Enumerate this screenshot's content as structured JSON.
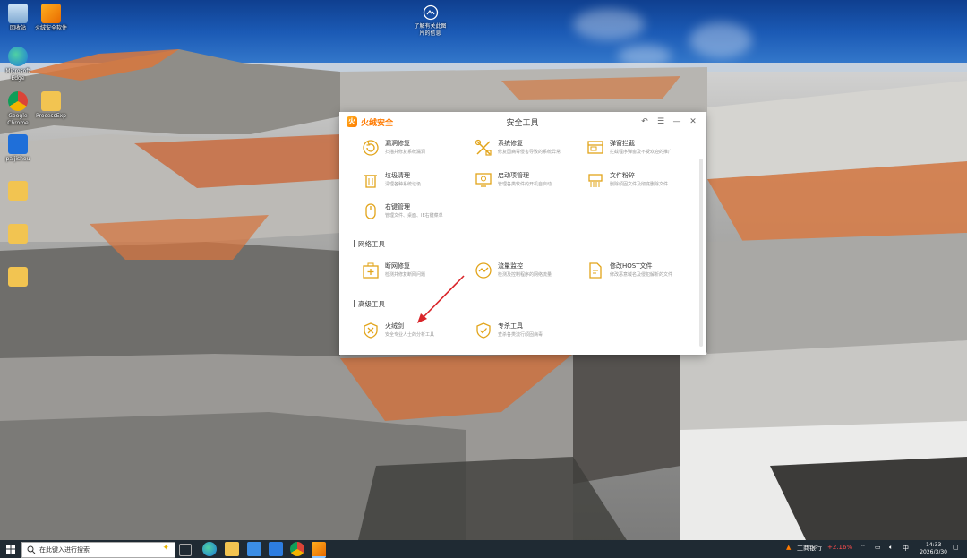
{
  "desktop": {
    "icons": [
      {
        "label": "回收站",
        "icon": "recycle-bin-icon"
      },
      {
        "label": "火绒安全软件",
        "icon": "huorong-icon"
      },
      {
        "label": "Microsoft Edge",
        "icon": "edge-icon"
      },
      {
        "label": "Google Chrome",
        "icon": "chrome-icon"
      },
      {
        "label": "ProcessExp",
        "icon": "folder-icon"
      },
      {
        "label": "paijishou",
        "icon": "app-icon"
      },
      {
        "label": "",
        "icon": "folder-icon"
      },
      {
        "label": "",
        "icon": "folder-icon"
      },
      {
        "label": "",
        "icon": "folder-icon"
      }
    ],
    "center_icon": {
      "label_line1": "了解有关此图",
      "label_line2": "片的信息"
    }
  },
  "window": {
    "app_name": "火绒安全",
    "title": "安全工具",
    "controls": [
      "↶",
      "☰",
      "—",
      "✕"
    ],
    "sections": [
      {
        "title": "",
        "tools": [
          {
            "name": "漏洞修复",
            "desc": "扫描并修复系统漏洞",
            "icon": "refresh-icon"
          },
          {
            "name": "系统修复",
            "desc": "修复因病毒侵害导致的系统异常",
            "icon": "wrench-icon"
          },
          {
            "name": "弹窗拦截",
            "desc": "拦截程序弹窗及不受欢迎的推广",
            "icon": "popup-icon"
          },
          {
            "name": "垃圾清理",
            "desc": "清理各种系统垃圾",
            "icon": "trash-icon"
          },
          {
            "name": "启动项管理",
            "desc": "管理各类软件的开机自启动",
            "icon": "monitor-icon"
          },
          {
            "name": "文件粉碎",
            "desc": "删除顽固文件及彻底删除文件",
            "icon": "shredder-icon"
          },
          {
            "name": "右键管理",
            "desc": "管理文件、桌面、IE右键菜单",
            "icon": "mouse-icon"
          }
        ]
      },
      {
        "title": "网络工具",
        "tools": [
          {
            "name": "断网修复",
            "desc": "检测并修复断网问题",
            "icon": "medkit-icon"
          },
          {
            "name": "流量监控",
            "desc": "检测及控制程序的网络流量",
            "icon": "traffic-icon"
          },
          {
            "name": "修改HOST文件",
            "desc": "修改恶意域名及侵犯解析的文件",
            "icon": "file-edit-icon"
          }
        ]
      },
      {
        "title": "高级工具",
        "tools": [
          {
            "name": "火绒剑",
            "desc": "安全专业人士的分析工具",
            "icon": "sword-icon"
          },
          {
            "name": "专杀工具",
            "desc": "查杀各类流行顽固病毒",
            "icon": "shield-icon"
          }
        ]
      }
    ]
  },
  "taskbar": {
    "search_placeholder": "在此键入进行搜索",
    "stock_name": "工商银行",
    "stock_change": "+2.16%",
    "stock_color": "#ff4d4d",
    "lang": "中",
    "time": "14:33",
    "date": "2026/3/30"
  },
  "colors": {
    "accent": "#e2a41a",
    "brand": "#ff7a00",
    "arrow": "#d9252a"
  }
}
